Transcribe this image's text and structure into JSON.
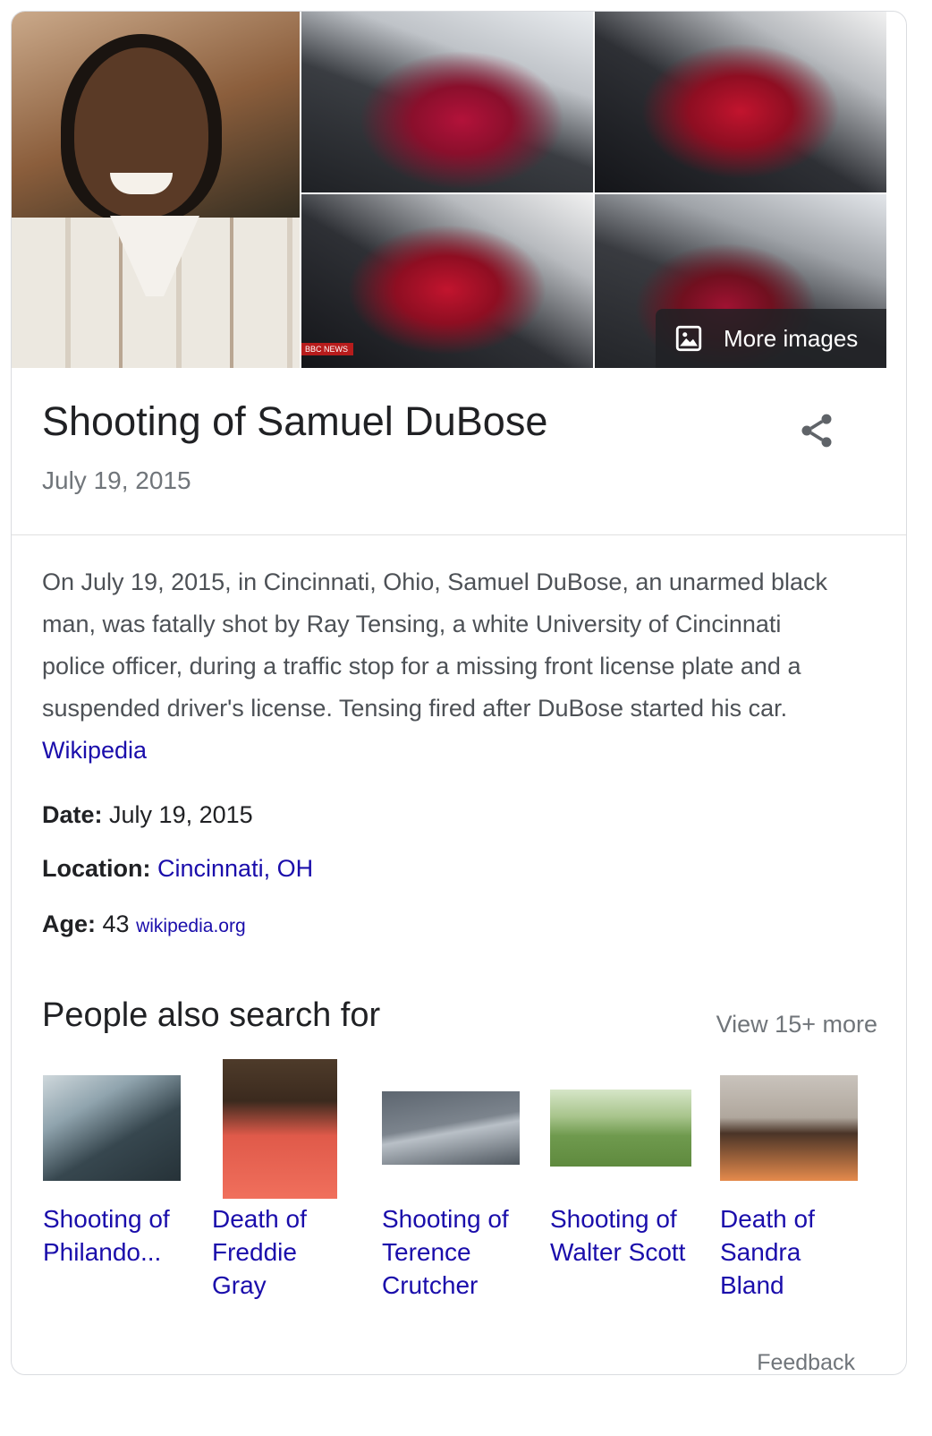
{
  "images": {
    "more_images_label": "More images",
    "news_badge": "BBC NEWS"
  },
  "header": {
    "title": "Shooting of Samuel DuBose",
    "subtitle": "July 19, 2015"
  },
  "description": {
    "text": "On July 19, 2015, in Cincinnati, Ohio, Samuel DuBose, an unarmed black man, was fatally shot by Ray Tensing, a white University of Cincinnati police officer, during a traffic stop for a missing front license plate and a suspended driver's license. Tensing fired after DuBose started his car. ",
    "source_link": "Wikipedia"
  },
  "facts": {
    "date_label": "Date:",
    "date_value": "July 19, 2015",
    "location_label": "Location:",
    "location_value": "Cincinnati, OH",
    "age_label": "Age:",
    "age_value": "43",
    "age_source": "wikipedia.org"
  },
  "people_also_search": {
    "title": "People also search for",
    "view_more": "View 15+ more",
    "items": [
      {
        "label": "Shooting of Philando..."
      },
      {
        "label": "Death of Freddie Gray"
      },
      {
        "label": "Shooting of Terence Crutcher"
      },
      {
        "label": "Shooting of Walter Scott"
      },
      {
        "label": "Death of Sandra Bland"
      }
    ]
  },
  "footer": {
    "feedback": "Feedback"
  },
  "colors": {
    "link": "#1a0dab",
    "secondary_text": "#70757a",
    "primary_text": "#202124"
  }
}
